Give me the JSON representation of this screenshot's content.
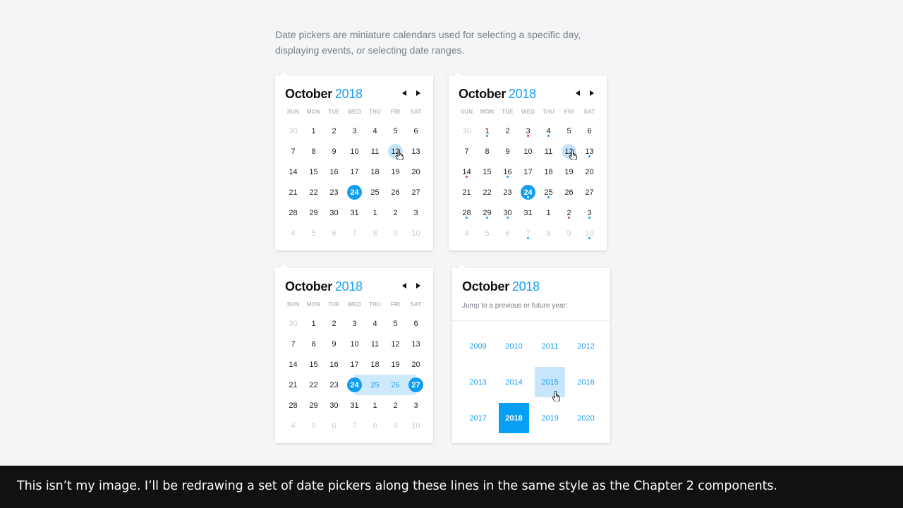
{
  "intro": "Date pickers are miniature calendars used for selecting a specific day, displaying events, or selecting date ranges.",
  "month": "October",
  "year": "2018",
  "weekdays": [
    "SUN",
    "MON",
    "TUE",
    "WED",
    "THU",
    "FRI",
    "SAT"
  ],
  "weeks": [
    [
      "30",
      "1",
      "2",
      "3",
      "4",
      "5",
      "6"
    ],
    [
      "7",
      "8",
      "9",
      "10",
      "11",
      "12",
      "13"
    ],
    [
      "14",
      "15",
      "16",
      "17",
      "18",
      "19",
      "20"
    ],
    [
      "21",
      "22",
      "23",
      "24",
      "25",
      "26",
      "27"
    ],
    [
      "28",
      "29",
      "30",
      "31",
      "1",
      "2",
      "3"
    ],
    [
      "4",
      "5",
      "6",
      "7",
      "8",
      "9",
      "10"
    ]
  ],
  "pickers": {
    "simple": {
      "selected": "24",
      "hovered": "12"
    },
    "events": {
      "selected": "24",
      "hovered": "12",
      "event_colors": {
        "blue": "#1a9ff0",
        "red": "#e53935"
      },
      "note": "dots under days mark events"
    },
    "range": {
      "start": "24",
      "end": "27"
    },
    "year": {
      "subtitle": "Jump to a previous or future year:",
      "years": [
        "2009",
        "2010",
        "2011",
        "2012",
        "2013",
        "2014",
        "2015",
        "2016",
        "2017",
        "2018",
        "2019",
        "2020"
      ],
      "current": "2018",
      "hovered": "2015"
    }
  },
  "colors": {
    "accent": "#129ef0",
    "hover": "#c2e4fb",
    "range": "#cfe9fc",
    "muted": "#c8cbd0"
  },
  "caption": "This isn’t my image. I’ll be redrawing a set of date pickers along these lines in the same style as the Chapter 2 components."
}
